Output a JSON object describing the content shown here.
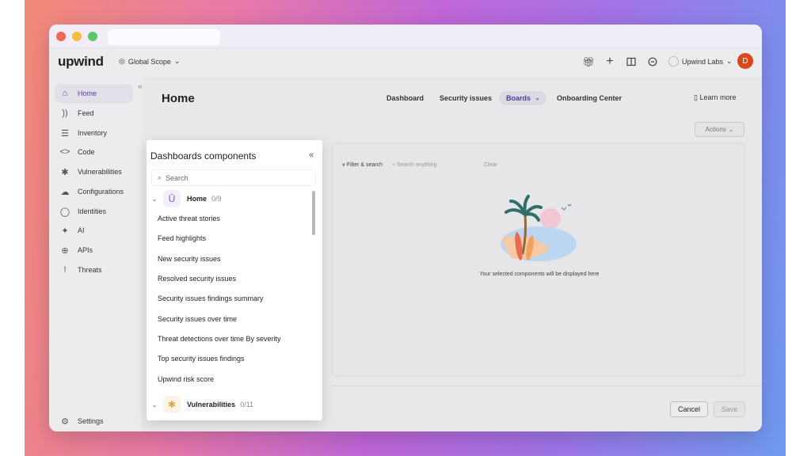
{
  "app": {
    "logo": "upwind",
    "scope": "Global Scope",
    "org": "Upwind Labs",
    "avatar_initial": "D"
  },
  "sidebar": {
    "items": [
      {
        "label": "Home",
        "icon": "home-icon",
        "active": true
      },
      {
        "label": "Feed",
        "icon": "feed-icon"
      },
      {
        "label": "Inventory",
        "icon": "list-icon"
      },
      {
        "label": "Code",
        "icon": "code-icon"
      },
      {
        "label": "Vulnerabilities",
        "icon": "bug-icon"
      },
      {
        "label": "Configurations",
        "icon": "cloud-icon"
      },
      {
        "label": "Identities",
        "icon": "user-icon"
      },
      {
        "label": "AI",
        "icon": "sparkle-icon"
      },
      {
        "label": "APIs",
        "icon": "globe-icon"
      },
      {
        "label": "Threats",
        "icon": "exclamation-icon"
      }
    ],
    "settings": "Settings"
  },
  "main": {
    "title": "Home",
    "tabs": [
      "Dashboard",
      "Security issues",
      "Boards",
      "Onboarding Center"
    ],
    "learn_more": "Learn more",
    "actions": "Actions",
    "filter": "Filter & search",
    "search_placeholder": "Search anything",
    "clear": "Clear",
    "empty_message": "Your selected components will be displayed here",
    "cancel": "Cancel",
    "save": "Save"
  },
  "panel": {
    "title": "Dashboards components",
    "search_placeholder": "Search",
    "groups": [
      {
        "name": "Home",
        "count": "0/9"
      },
      {
        "name": "Vulnerabilities",
        "count": "0/11"
      }
    ],
    "home_components": [
      "Active threat stories",
      "Feed highlights",
      "New security issues",
      "Resolved security issues",
      "Security issues findings summary",
      "Security issues over time",
      "Threat detections over time By severity",
      "Top security issues findings",
      "Upwind risk score"
    ]
  }
}
